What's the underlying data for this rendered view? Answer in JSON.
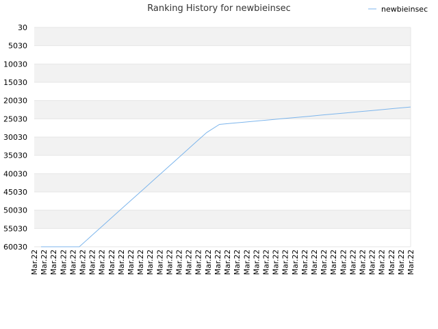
{
  "chart_data": {
    "type": "line",
    "title": "Ranking History for newbieinsec",
    "xlabel": "",
    "ylabel": "",
    "y_axis_inverted": true,
    "ylim": [
      30,
      60030
    ],
    "yticks": [
      "30",
      "5030",
      "10030",
      "15030",
      "20030",
      "25030",
      "30030",
      "35030",
      "40030",
      "45030",
      "50030",
      "55030",
      "60030"
    ],
    "x": [
      "Mar.22",
      "Mar.22",
      "Mar.22",
      "Mar.22",
      "Mar.22",
      "Mar.22",
      "Mar.22",
      "Mar.22",
      "Mar.22",
      "Mar.22",
      "Mar.22",
      "Mar.22",
      "Mar.22",
      "Mar.22",
      "Mar.22",
      "Mar.22",
      "Mar.22",
      "Mar.22",
      "Mar.22",
      "Mar.22",
      "Mar.22",
      "Mar.22",
      "Mar.22",
      "Mar.22",
      "Mar.22",
      "Mar.22",
      "Mar.22",
      "Mar.22",
      "Mar.22",
      "Mar.22",
      "Mar.22",
      "Mar.22",
      "Mar.22",
      "Mar.22",
      "Mar.22",
      "Mar.22",
      "Mar.22",
      "Mar.22",
      "Mar.22",
      "Mar.22"
    ],
    "series": [
      {
        "name": "newbieinsec",
        "color": "#7cb5ec",
        "values": [
          60030,
          60030,
          60030,
          60030,
          56890,
          53770,
          50640,
          47520,
          44390,
          41270,
          38140,
          35020,
          31890,
          28770,
          26560,
          26240,
          25930,
          25610,
          25290,
          24970,
          24660,
          24340,
          24020,
          23710,
          23390,
          23070,
          22750,
          22440,
          22120,
          21800
        ]
      }
    ],
    "grid": true,
    "legend": "top-right",
    "band_colors": [
      "#f2f2f2",
      "#ffffff"
    ]
  }
}
